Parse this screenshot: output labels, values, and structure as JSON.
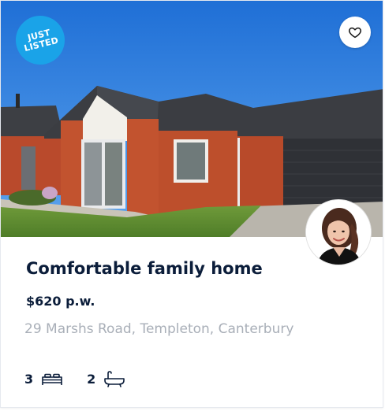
{
  "listing": {
    "badge_line1": "JUST",
    "badge_line2": "LISTED",
    "title": "Comfortable family home",
    "price": "$620 p.w.",
    "address": "29 Marshs Road, Templeton, Canterbury",
    "bedrooms": "3",
    "bathrooms": "2"
  },
  "icons": {
    "favourite": "heart-icon",
    "bedrooms": "bed-icon",
    "bathrooms": "bathtub-icon"
  },
  "colors": {
    "badge": "#1aa3e8",
    "title": "#0b1d3a",
    "address": "#a9afb8"
  }
}
